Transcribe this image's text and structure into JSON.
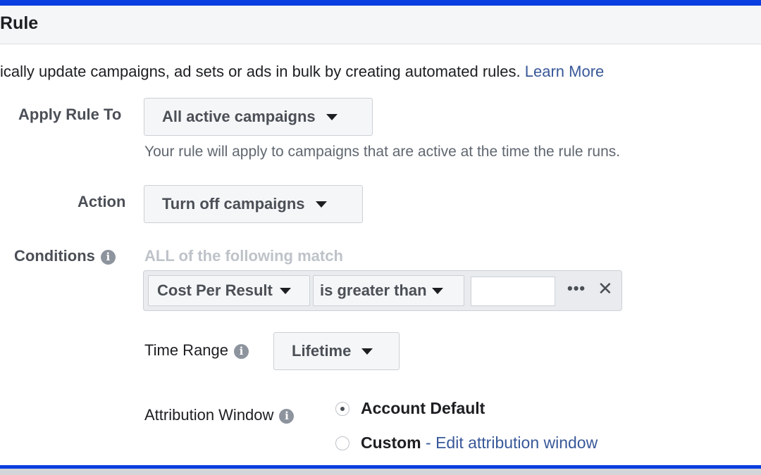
{
  "header": {
    "title": "Rule"
  },
  "intro": {
    "text": "ically update campaigns, ad sets or ads in bulk by creating automated rules. ",
    "link": "Learn More"
  },
  "apply_rule": {
    "label": "Apply Rule To",
    "value": "All active campaigns",
    "hint": "Your rule will apply to campaigns that are active at the time the rule runs."
  },
  "action": {
    "label": "Action",
    "value": "Turn off campaigns"
  },
  "conditions": {
    "label": "Conditions",
    "match_text": "ALL of the following match",
    "metric": "Cost Per Result",
    "operator": "is greater than",
    "value": "",
    "more_glyph": "•••",
    "remove_glyph": "✕"
  },
  "time_range": {
    "label": "Time Range",
    "value": "Lifetime"
  },
  "attribution": {
    "label": "Attribution Window",
    "options": [
      {
        "label": "Account Default",
        "selected": true
      },
      {
        "label": "Custom",
        "separator": " - ",
        "link": "Edit attribution window",
        "selected": false
      }
    ]
  },
  "icons": {
    "info": "info-icon",
    "caret": "caret-down-icon",
    "more": "more-icon",
    "close": "close-icon"
  },
  "colors": {
    "frame": "#0a3ee0",
    "link": "#385898",
    "header_bg": "#f5f6f7"
  }
}
